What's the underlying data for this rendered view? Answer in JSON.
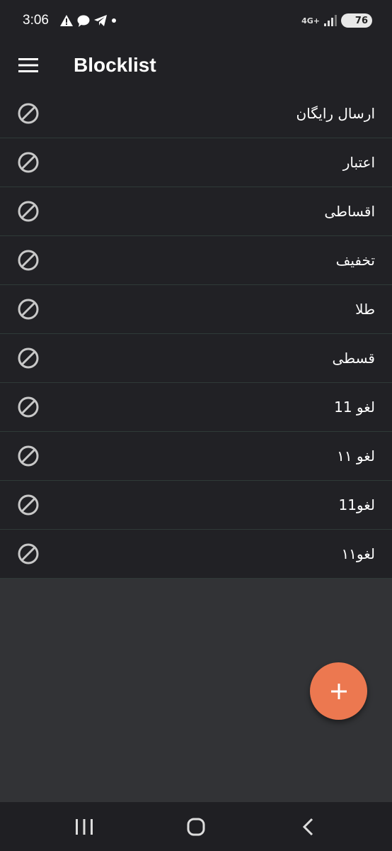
{
  "status_bar": {
    "time": "3:06",
    "network": "4G+",
    "battery": "76",
    "icons": [
      "warning-icon",
      "chat-bubble-icon",
      "telegram-icon",
      "dot-icon",
      "signal-icon",
      "battery-icon"
    ]
  },
  "app_bar": {
    "title": "Blocklist",
    "menu_icon": "hamburger-menu-icon"
  },
  "blocklist": {
    "items": [
      {
        "label": "ارسال رایگان"
      },
      {
        "label": "اعتبار"
      },
      {
        "label": "اقساطی"
      },
      {
        "label": "تخفیف"
      },
      {
        "label": "طلا"
      },
      {
        "label": "قسطی"
      },
      {
        "label": "لغو 11"
      },
      {
        "label": "لغو ۱۱"
      },
      {
        "label": "لغو11"
      },
      {
        "label": "لغو۱۱"
      }
    ],
    "item_icon": "block-icon"
  },
  "fab": {
    "icon": "plus-icon",
    "color": "#ec7850"
  },
  "nav_bar": {
    "buttons": [
      "recents-icon",
      "home-icon",
      "back-icon"
    ]
  },
  "colors": {
    "surface": "#212125",
    "background": "#323336",
    "accent": "#ec7850",
    "divider": "#2f3a38"
  }
}
